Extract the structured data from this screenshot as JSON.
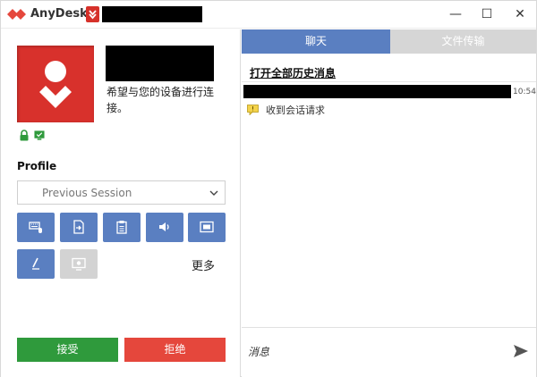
{
  "app": {
    "name": "AnyDesk",
    "brand_color": "#d8312c"
  },
  "window_controls": {
    "minimize": "—",
    "maximize": "☐",
    "close": "✕"
  },
  "request": {
    "message": "希望与您的设备进行连接。"
  },
  "profile": {
    "label": "Profile",
    "selected": "Previous Session"
  },
  "permissions": {
    "items": [
      "keyboard-mouse",
      "file-transfer",
      "clipboard",
      "audio",
      "screen",
      "draw",
      "privacy-screen"
    ],
    "more_label": "更多"
  },
  "actions": {
    "accept": "接受",
    "reject": "拒绝"
  },
  "chat": {
    "tabs": {
      "chat": "聊天",
      "files": "文件传输"
    },
    "history_link": "打开全部历史消息",
    "messages": [
      {
        "time": "10:54",
        "notice": "收到会话请求"
      }
    ],
    "input_placeholder": "消息"
  }
}
